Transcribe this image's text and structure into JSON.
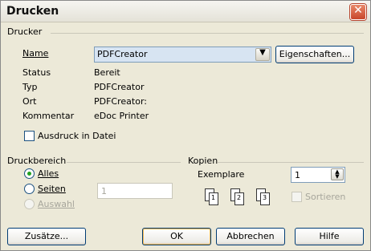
{
  "window": {
    "title": "Drucken"
  },
  "printer": {
    "section_label": "Drucker",
    "name_label": "Name",
    "name_value": "PDFCreator",
    "properties_button": "Eigenschaften...",
    "status_label": "Status",
    "status_value": "Bereit",
    "type_label": "Typ",
    "type_value": "PDFCreator",
    "location_label": "Ort",
    "location_value": "PDFCreator:",
    "comment_label": "Kommentar",
    "comment_value": "eDoc Printer",
    "print_to_file_label": "Ausdruck in Datei",
    "print_to_file_checked": false
  },
  "print_range": {
    "section_label": "Druckbereich",
    "all_label": "Alles",
    "pages_label": "Seiten",
    "pages_value": "1",
    "selection_label": "Auswahl",
    "selected": "all"
  },
  "copies": {
    "section_label": "Kopien",
    "count_label": "Exemplare",
    "count_value": "1",
    "collate_label": "Sortieren",
    "collate_checked": false,
    "page_numbers": [
      "1",
      "2",
      "3"
    ]
  },
  "buttons": {
    "extras": "Zusätze...",
    "ok": "OK",
    "cancel": "Abbrechen",
    "help": "Hilfe"
  },
  "colors": {
    "accent": "#21a121",
    "close": "#c8462b",
    "selection": "#d7e4f2"
  },
  "icons": [
    "close-icon",
    "chevron-down-icon",
    "spin-up-icon",
    "spin-down-icon",
    "page-icon"
  ]
}
